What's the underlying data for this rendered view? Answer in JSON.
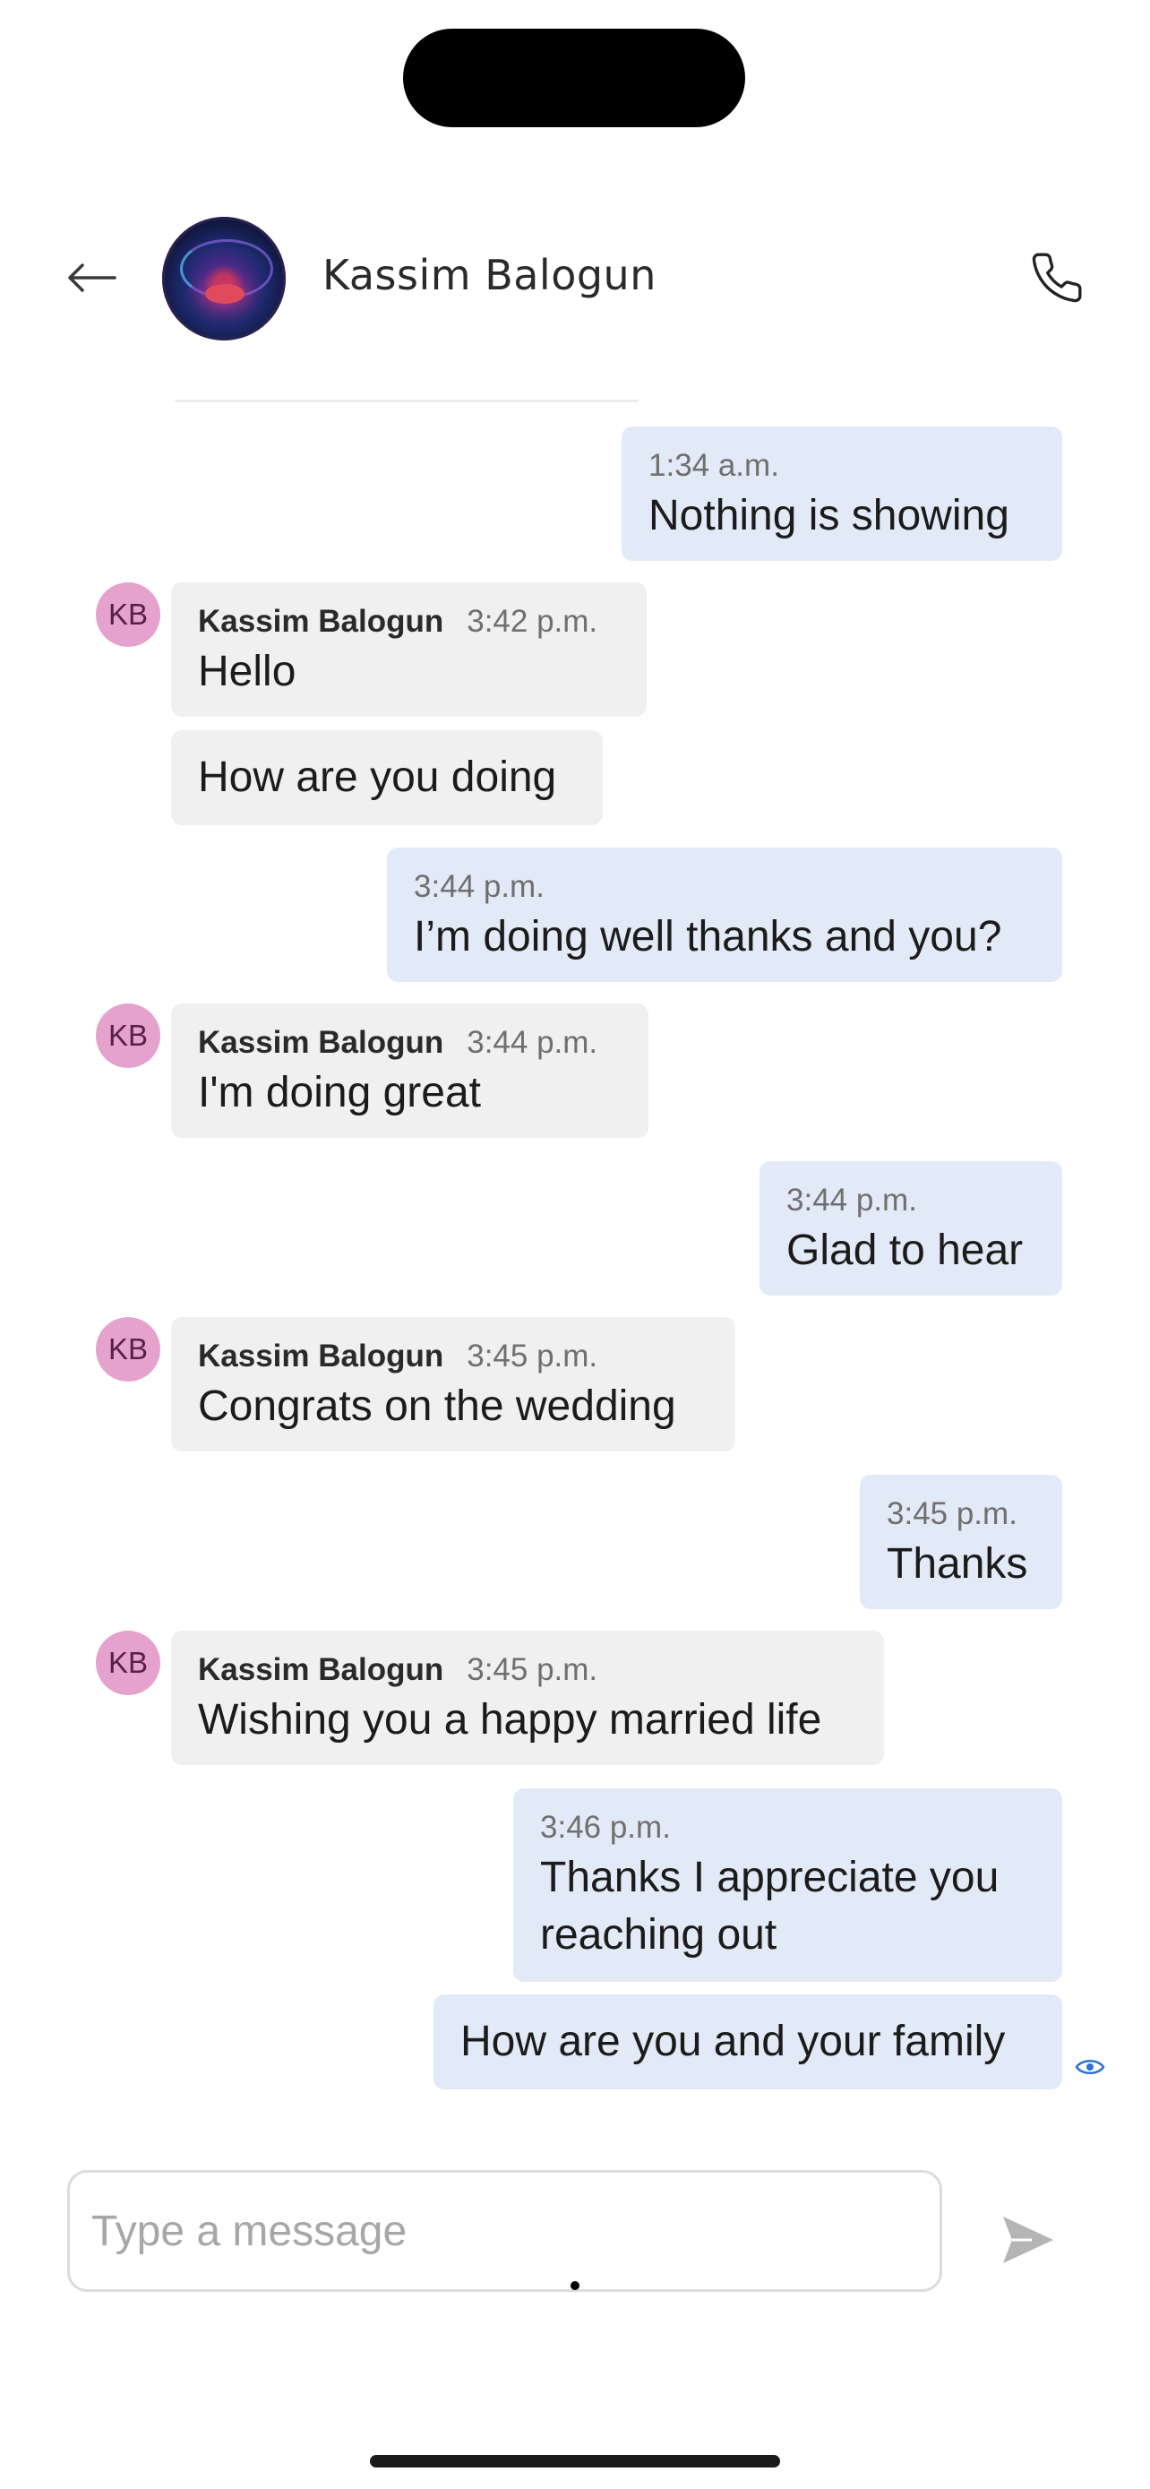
{
  "header": {
    "contact_name": "Kassim Balogun",
    "back_icon": "arrow-left-icon",
    "call_icon": "phone-icon"
  },
  "messages": [
    {
      "direction": "out",
      "time": "1:34 a.m.",
      "text": "Nothing is showing"
    },
    {
      "direction": "in",
      "initials": "KB",
      "sender": "Kassim Balogun",
      "time": "3:42 p.m.",
      "text": "Hello"
    },
    {
      "direction": "in",
      "text": "How are you doing"
    },
    {
      "direction": "out",
      "time": "3:44 p.m.",
      "text": "I’m doing well thanks and you?"
    },
    {
      "direction": "in",
      "initials": "KB",
      "sender": "Kassim Balogun",
      "time": "3:44 p.m.",
      "text": "I'm doing great"
    },
    {
      "direction": "out",
      "time": "3:44 p.m.",
      "text": "Glad to hear"
    },
    {
      "direction": "in",
      "initials": "KB",
      "sender": "Kassim Balogun",
      "time": "3:45 p.m.",
      "text": "Congrats on the wedding"
    },
    {
      "direction": "out",
      "time": "3:45 p.m.",
      "text": "Thanks"
    },
    {
      "direction": "in",
      "initials": "KB",
      "sender": "Kassim Balogun",
      "time": "3:45 p.m.",
      "text": "Wishing you a happy married life"
    },
    {
      "direction": "out",
      "time": "3:46 p.m.",
      "text": "Thanks I appreciate you reaching out"
    },
    {
      "direction": "out",
      "text": "How are you and your family",
      "status_icon": "seen-eye-icon"
    }
  ],
  "composer": {
    "placeholder": "Type a message",
    "value": "",
    "send_icon": "send-icon"
  },
  "colors": {
    "outgoing_bubble": "#e1eaf6",
    "incoming_bubble": "#f0f0f0",
    "avatar_initials_bg": "#e4a2cd",
    "accent": "#2f6fd6"
  }
}
